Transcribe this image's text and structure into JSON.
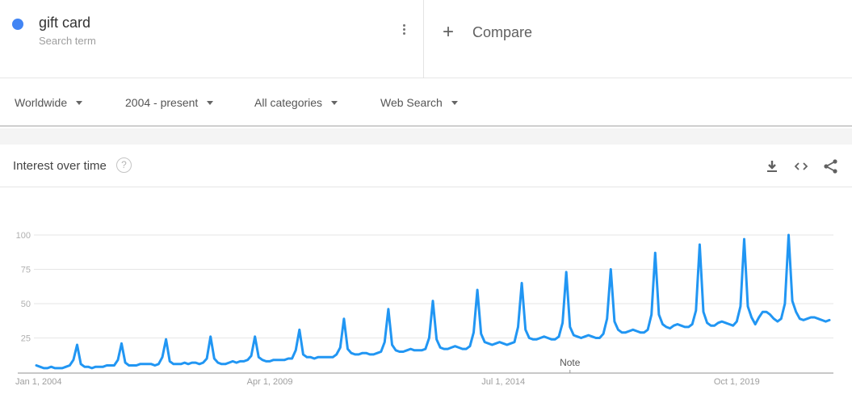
{
  "term": {
    "name": "gift card",
    "subtitle": "Search term",
    "color": "#4285f4",
    "menu_icon": "more-vert-icon"
  },
  "compare": {
    "icon": "plus-icon",
    "label": "Compare"
  },
  "filters": [
    {
      "label": "Worldwide"
    },
    {
      "label": "2004 - present"
    },
    {
      "label": "All categories"
    },
    {
      "label": "Web Search"
    }
  ],
  "card": {
    "title": "Interest over time",
    "help_icon": "?",
    "tools": [
      "download-icon",
      "embed-code-icon",
      "share-icon"
    ]
  },
  "chart_data": {
    "type": "line",
    "title": "Interest over time",
    "xlabel": "",
    "ylabel": "",
    "ylim": [
      0,
      100
    ],
    "y_ticks": [
      25,
      50,
      75,
      100
    ],
    "x_tick_labels": [
      "Jan 1, 2004",
      "Apr 1, 2009",
      "Jul 1, 2014",
      "Oct 1, 2019"
    ],
    "x_tick_months": [
      0,
      63,
      126,
      189
    ],
    "grid": true,
    "line_color": "#2196f3",
    "note": {
      "label": "Note",
      "month": 144
    },
    "start": "2004-01",
    "series": [
      {
        "name": "gift card",
        "values": [
          5,
          4,
          3,
          3,
          4,
          3,
          3,
          3,
          4,
          5,
          9,
          20,
          6,
          4,
          4,
          3,
          4,
          4,
          4,
          5,
          5,
          5,
          9,
          21,
          7,
          5,
          5,
          5,
          6,
          6,
          6,
          6,
          5,
          6,
          11,
          24,
          8,
          6,
          6,
          6,
          7,
          6,
          7,
          7,
          6,
          7,
          10,
          26,
          10,
          7,
          6,
          6,
          7,
          8,
          7,
          8,
          8,
          9,
          12,
          26,
          11,
          9,
          8,
          8,
          9,
          9,
          9,
          9,
          10,
          10,
          16,
          31,
          13,
          11,
          11,
          10,
          11,
          11,
          11,
          11,
          11,
          13,
          18,
          39,
          17,
          14,
          13,
          13,
          14,
          14,
          13,
          13,
          14,
          15,
          22,
          46,
          20,
          16,
          15,
          15,
          16,
          17,
          16,
          16,
          16,
          17,
          25,
          52,
          24,
          18,
          17,
          17,
          18,
          19,
          18,
          17,
          17,
          19,
          29,
          60,
          28,
          22,
          21,
          20,
          21,
          22,
          21,
          20,
          21,
          22,
          33,
          65,
          31,
          25,
          24,
          24,
          25,
          26,
          25,
          24,
          24,
          26,
          36,
          73,
          33,
          27,
          26,
          25,
          26,
          27,
          26,
          25,
          25,
          28,
          39,
          75,
          37,
          31,
          29,
          29,
          30,
          31,
          30,
          29,
          29,
          31,
          42,
          87,
          42,
          35,
          33,
          32,
          34,
          35,
          34,
          33,
          33,
          35,
          45,
          93,
          44,
          36,
          34,
          34,
          36,
          37,
          36,
          35,
          34,
          37,
          48,
          97,
          48,
          40,
          35,
          40,
          44,
          44,
          42,
          39,
          37,
          39,
          50,
          100,
          52,
          44,
          39,
          38,
          39,
          40,
          40,
          39,
          38,
          37,
          38
        ]
      }
    ]
  }
}
